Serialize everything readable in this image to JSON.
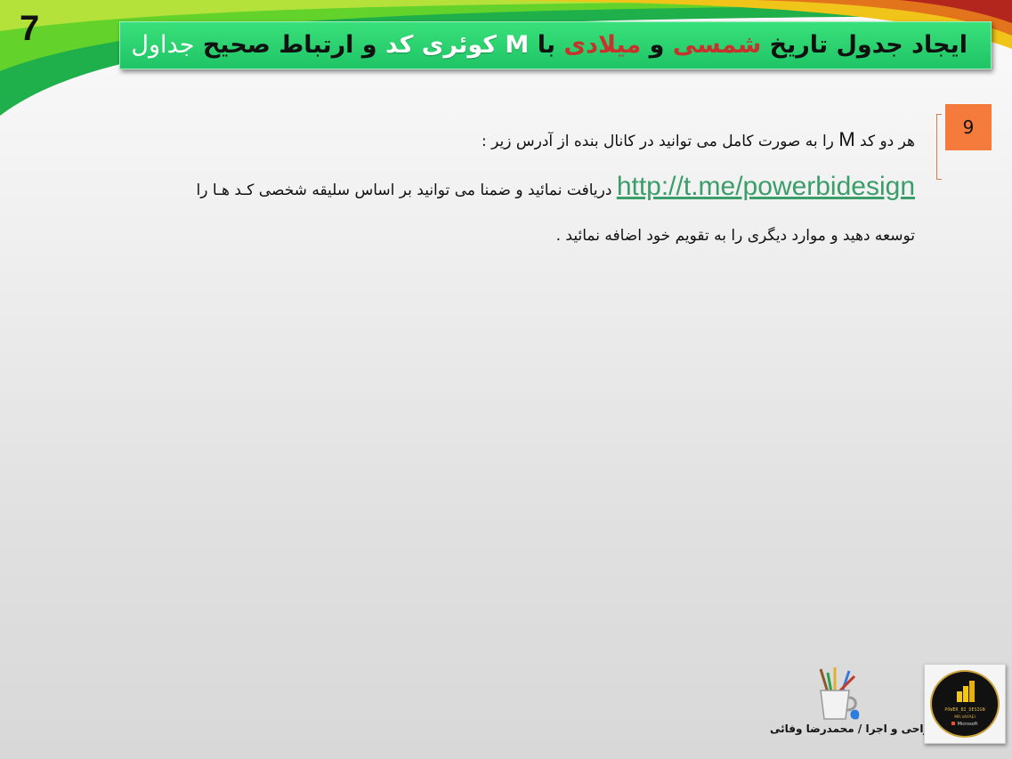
{
  "slide_number": "7",
  "title": {
    "segments": [
      {
        "text": "ایجاد جدول تاریخ ",
        "style": "dark"
      },
      {
        "text": "شمسی",
        "style": "red"
      },
      {
        "text": " و ",
        "style": "dark"
      },
      {
        "text": "میلادی",
        "style": "red"
      },
      {
        "text": " با ",
        "style": "dark"
      },
      {
        "text": "M",
        "style": "white"
      },
      {
        "text": " کوئری کد",
        "style": "white"
      },
      {
        "text": " و ارتباط صحیح ",
        "style": "dark"
      },
      {
        "text": "جداول",
        "style": "light"
      }
    ]
  },
  "item_number": "9",
  "body": {
    "line1_before_m": "هر دو کد ",
    "line1_m": "M",
    "line1_after_m": " را به صورت کامل می توانید در کانال بنده از آدرس زیر :",
    "line2_link": "http://t.me/powerbidesign",
    "line2_text": " دریافت نمائید و ضمنا می توانید بر اساس سلیقه شخصی کـد هـا را",
    "line3": "توسعه دهید و موارد دیگری را به تقویم خود اضافه نمائید ."
  },
  "credit": "طراحی و اجرا / محمدرضا وفائی",
  "logo": {
    "line1": "POWER_BI_DESIGN",
    "line2": "MR.VAFAEI",
    "line3": "Microsoft"
  },
  "colors": {
    "banner": "#22c96a",
    "accent_red": "#c8322c",
    "badge": "#f47b3c",
    "link": "#3a9d6a"
  }
}
